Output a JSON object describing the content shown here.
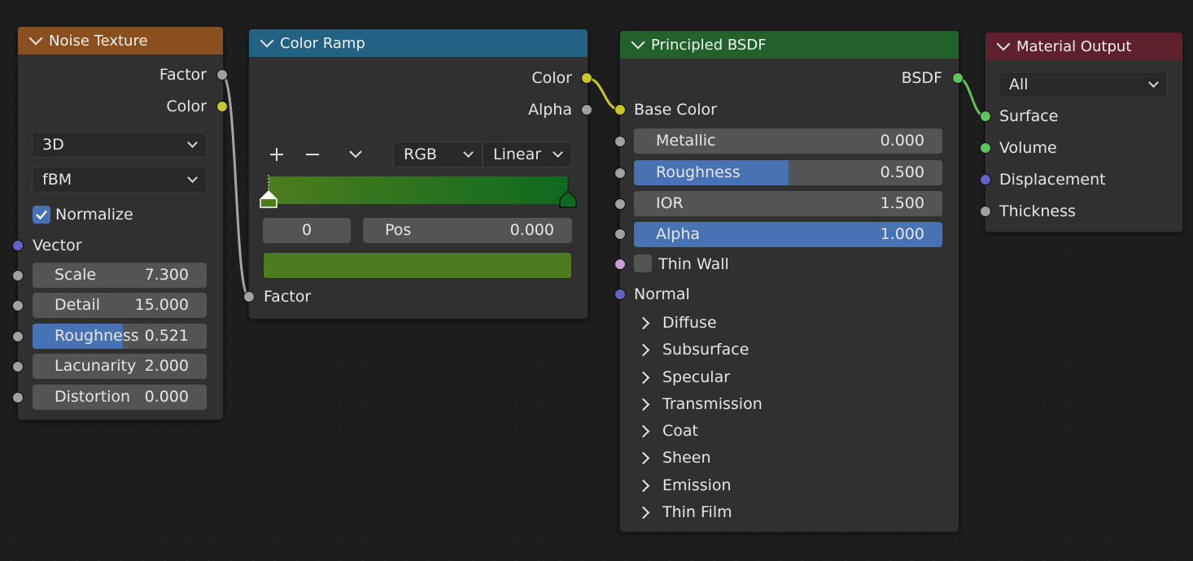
{
  "colors": {
    "noise_header": "#8a4f1f",
    "ramp_header": "#246283",
    "bsdf_header": "#21622a",
    "output_header": "#5e202c",
    "value_fill": "#4772b3",
    "ramp_start": "#4c7c1e",
    "ramp_end": "#0e6a1e"
  },
  "noise_texture": {
    "title": "Noise Texture",
    "outputs": [
      "Factor",
      "Color"
    ],
    "dimension": "3D",
    "type": "fBM",
    "normalize_label": "Normalize",
    "normalize_checked": true,
    "vector_label": "Vector",
    "fields": [
      {
        "name": "Scale",
        "value": "7.300"
      },
      {
        "name": "Detail",
        "value": "15.000"
      },
      {
        "name": "Roughness",
        "value": "0.521",
        "fill": 0.521
      },
      {
        "name": "Lacunarity",
        "value": "2.000"
      },
      {
        "name": "Distortion",
        "value": "0.000"
      }
    ]
  },
  "color_ramp": {
    "title": "Color Ramp",
    "outputs": [
      "Color",
      "Alpha"
    ],
    "color_mode": "RGB",
    "interpolation": "Linear",
    "stop_index": "0",
    "pos_label": "Pos",
    "pos_value": "0.000",
    "factor_label": "Factor",
    "add_icon": "plus-icon",
    "remove_icon": "minus-icon",
    "menu_icon": "chevron-down-icon"
  },
  "principled_bsdf": {
    "title": "Principled BSDF",
    "output": "BSDF",
    "base_color_label": "Base Color",
    "fields": [
      {
        "name": "Metallic",
        "value": "0.000"
      },
      {
        "name": "Roughness",
        "value": "0.500",
        "fill": 0.5
      },
      {
        "name": "IOR",
        "value": "1.500"
      },
      {
        "name": "Alpha",
        "value": "1.000",
        "fill": 1.0
      }
    ],
    "thin_wall_label": "Thin Wall",
    "normal_label": "Normal",
    "panels": [
      "Diffuse",
      "Subsurface",
      "Specular",
      "Transmission",
      "Coat",
      "Sheen",
      "Emission",
      "Thin Film"
    ]
  },
  "material_output": {
    "title": "Material Output",
    "target": "All",
    "inputs": [
      "Surface",
      "Volume",
      "Displacement",
      "Thickness"
    ]
  }
}
